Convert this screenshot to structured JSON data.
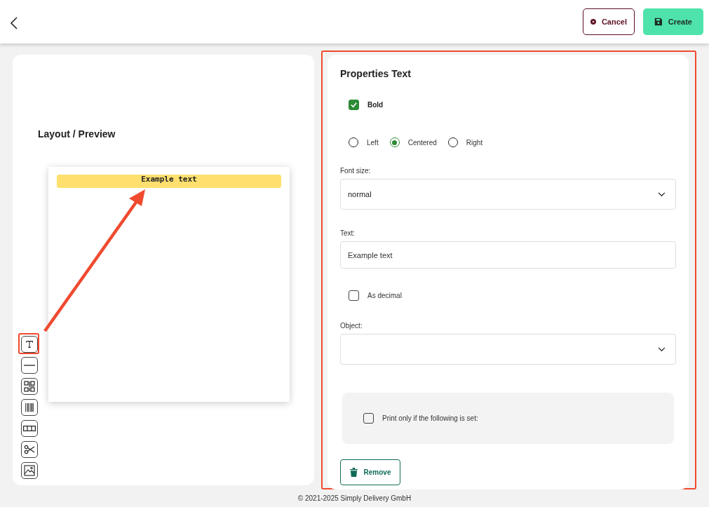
{
  "header": {
    "cancel": "Cancel",
    "create": "Create"
  },
  "preview": {
    "title": "Layout / Preview",
    "element_text": "Example text",
    "tools": [
      {
        "kind": "text",
        "selected": true
      },
      {
        "kind": "line",
        "selected": false
      },
      {
        "kind": "qr",
        "selected": false
      },
      {
        "kind": "barcode",
        "selected": false
      },
      {
        "kind": "columns",
        "selected": false
      },
      {
        "kind": "cut",
        "selected": false
      },
      {
        "kind": "image",
        "selected": false
      }
    ]
  },
  "properties": {
    "title": "Properties Text",
    "bold": {
      "label": "Bold",
      "checked": true
    },
    "alignment": [
      {
        "label": "Left",
        "selected": false
      },
      {
        "label": "Centered",
        "selected": true
      },
      {
        "label": "Right",
        "selected": false
      }
    ],
    "font_size": {
      "label": "Font size:",
      "value": "normal"
    },
    "text": {
      "label": "Text:",
      "value": "Example text"
    },
    "as_decimal": {
      "label": "As decimal",
      "checked": false
    },
    "object": {
      "label": "Object:"
    },
    "print_condition": {
      "label": "Print only if the following is set:",
      "checked": false
    },
    "remove": "Remove"
  },
  "footer": "© 2021-2025 Simply Delivery GmbH"
}
